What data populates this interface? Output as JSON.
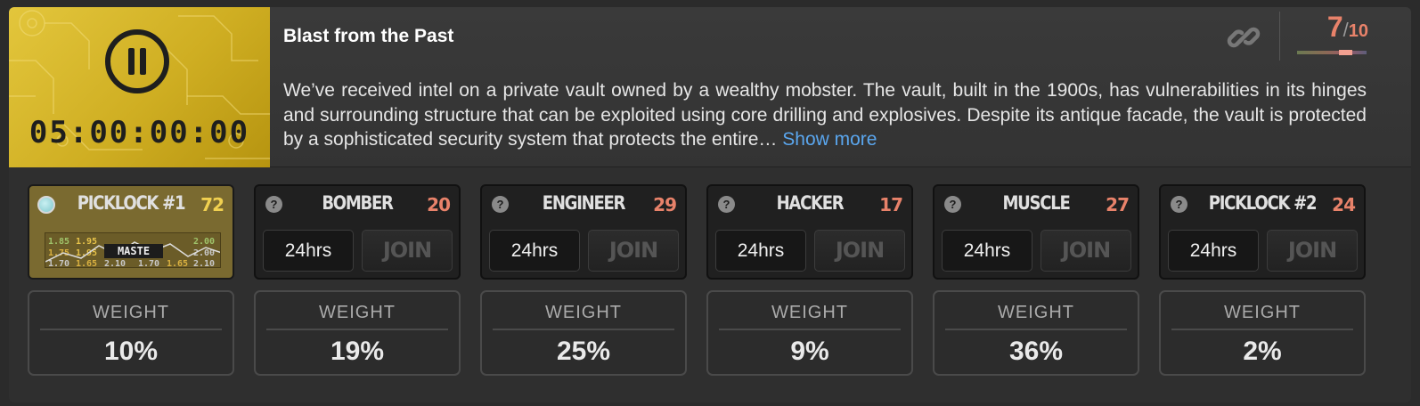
{
  "header": {
    "timer": "05:00:00:00",
    "title": "Blast from the Past",
    "score_current": "7",
    "score_sep": "/",
    "score_max": "10",
    "score_fraction": 0.7,
    "description": "We’ve received intel on a private vault owned by a wealthy mobster. The vault, built in the 1900s, has vulnerabilities in its hinges and surrounding structure that can be exploited using core drilling and explosives. Despite its antique facade, the vault is protected by a sophisticated security system that protects the entire…",
    "show_more": "Show more",
    "accent": "#e8826a",
    "link": "#5aa6ee"
  },
  "roles": [
    {
      "name": "PICKLOCK #1",
      "level": "72",
      "active": true,
      "mastery_label": "MASTE",
      "mastery_values": [
        "1.85",
        "1.95",
        "2.00",
        "1.75",
        "1.95",
        "2.00",
        "1.70",
        "1.65",
        "2.10",
        "1.70",
        "1.65",
        "2.10"
      ]
    },
    {
      "name": "BOMBER",
      "level": "20",
      "hours": "24hrs",
      "join": "JOIN"
    },
    {
      "name": "ENGINEER",
      "level": "29",
      "hours": "24hrs",
      "join": "JOIN"
    },
    {
      "name": "HACKER",
      "level": "17",
      "hours": "24hrs",
      "join": "JOIN"
    },
    {
      "name": "MUSCLE",
      "level": "27",
      "hours": "24hrs",
      "join": "JOIN"
    },
    {
      "name": "PICKLOCK #2",
      "level": "24",
      "hours": "24hrs",
      "join": "JOIN"
    }
  ],
  "weight_label": "WEIGHT",
  "weights": [
    "10%",
    "19%",
    "25%",
    "9%",
    "36%",
    "2%"
  ]
}
